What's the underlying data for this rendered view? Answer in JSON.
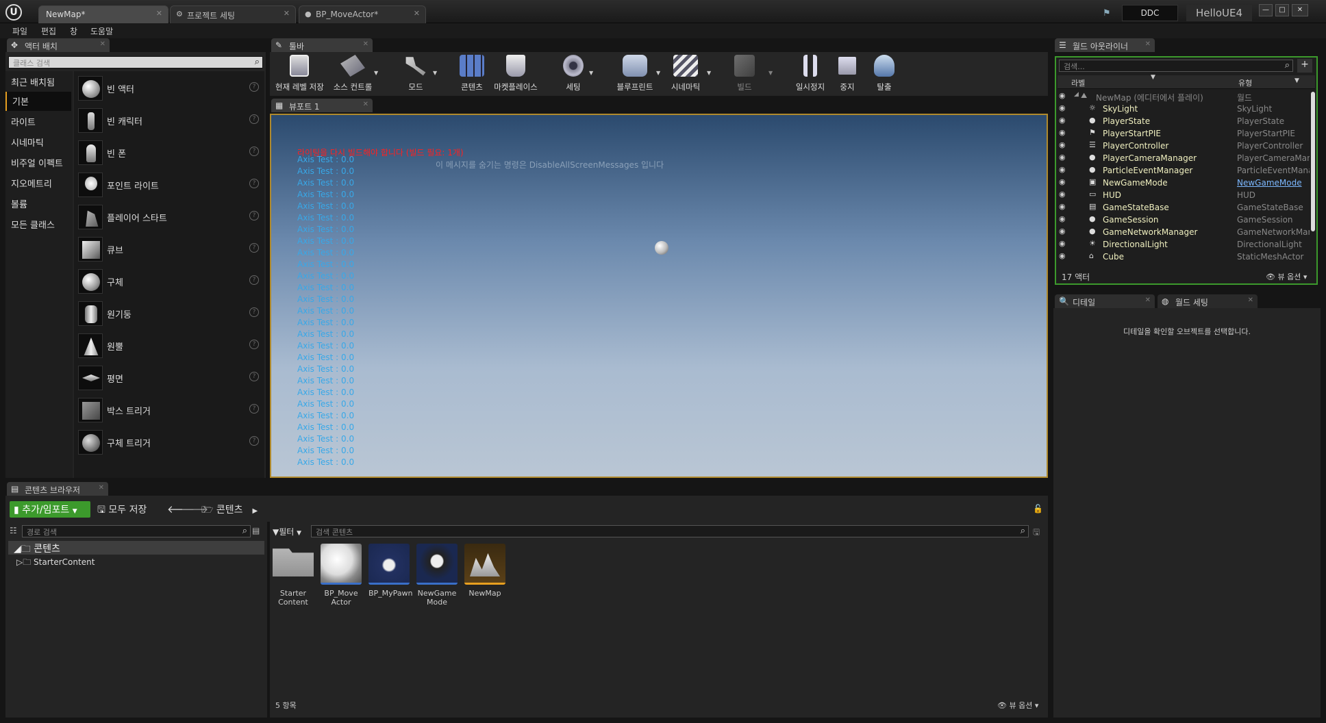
{
  "titlebar": {
    "tabs": [
      {
        "label": "NewMap*"
      },
      {
        "label": "프로젝트 세팅"
      },
      {
        "label": "BP_MoveActor*"
      }
    ],
    "ddc_label": "DDC",
    "project_name": "HelloUE4",
    "minimize": "—",
    "maximize": "□",
    "close": "✕"
  },
  "menu": {
    "items": [
      "파일",
      "편집",
      "창",
      "도움말"
    ]
  },
  "place_actors": {
    "tab": "액터 배치",
    "search_placeholder": "클래스 검색",
    "categories": [
      "최근 배치됨",
      "기본",
      "라이트",
      "시네마틱",
      "비주얼 이펙트",
      "지오메트리",
      "볼륨",
      "모든 클래스"
    ],
    "items": [
      "빈 액터",
      "빈 캐릭터",
      "빈 폰",
      "포인트 라이트",
      "플레이어 스타트",
      "큐브",
      "구체",
      "원기둥",
      "원뿔",
      "평면",
      "박스 트리거",
      "구체 트리거"
    ]
  },
  "toolbar": {
    "tab": "툴바",
    "buttons": [
      "현재 레벨 저장",
      "소스 컨트롤",
      "모드",
      "콘텐츠",
      "마켓플레이스",
      "세팅",
      "블루프린트",
      "시네마틱",
      "빌드",
      "일시정지",
      "중지",
      "탈출"
    ]
  },
  "viewport": {
    "tab": "뷰포트 1",
    "warning": "라이팅을 다시 빌드해야 합니다 (빌드 필요: 1개)",
    "hint": "이 메시지를 숨기는 명령은 DisableAllScreenMessages 입니다",
    "axis_lines": [
      "Axis Test : 0.0",
      "Axis Test : 0.0",
      "Axis Test : 0.0",
      "Axis Test : 0.0",
      "Axis Test : 0.0",
      "Axis Test : 0.0",
      "Axis Test : 0.0",
      "Axis Test : 0.0",
      "Axis Test : 0.0",
      "Axis Test : 0.0",
      "Axis Test : 0.0",
      "Axis Test : 0.0",
      "Axis Test : 0.0",
      "Axis Test : 0.0",
      "Axis Test : 0.0",
      "Axis Test : 0.0",
      "Axis Test : 0.0",
      "Axis Test : 0.0",
      "Axis Test : 0.0",
      "Axis Test : 0.0",
      "Axis Test : 0.0",
      "Axis Test : 0.0",
      "Axis Test : 0.0",
      "Axis Test : 0.0",
      "Axis Test : 0.0",
      "Axis Test : 0.0",
      "Axis Test : 0.0"
    ]
  },
  "outliner": {
    "tab": "월드 아웃라이너",
    "search_placeholder": "검색...",
    "col_label": "라벨",
    "col_type": "유형",
    "root": {
      "name": "NewMap (에디터에서 플레이)",
      "type": "월드"
    },
    "rows": [
      {
        "name": "SkyLight",
        "type": "SkyLight"
      },
      {
        "name": "PlayerState",
        "type": "PlayerState"
      },
      {
        "name": "PlayerStartPIE",
        "type": "PlayerStartPIE"
      },
      {
        "name": "PlayerController",
        "type": "PlayerController"
      },
      {
        "name": "PlayerCameraManager",
        "type": "PlayerCameraManager"
      },
      {
        "name": "ParticleEventManager",
        "type": "ParticleEventManager"
      },
      {
        "name": "NewGameMode",
        "type": "NewGameMode"
      },
      {
        "name": "HUD",
        "type": "HUD"
      },
      {
        "name": "GameStateBase",
        "type": "GameStateBase"
      },
      {
        "name": "GameSession",
        "type": "GameSession"
      },
      {
        "name": "GameNetworkManager",
        "type": "GameNetworkManager"
      },
      {
        "name": "DirectionalLight",
        "type": "DirectionalLight"
      },
      {
        "name": "Cube",
        "type": "StaticMeshActor"
      }
    ],
    "count": "17 액터",
    "view_options": "뷰 옵션"
  },
  "details": {
    "tab_details": "디테일",
    "tab_world": "월드 세팅",
    "empty_message": "디테일을 확인할 오브젝트를 선택합니다."
  },
  "content_browser": {
    "tab": "콘텐츠 브라우저",
    "add_import": "추가/임포트",
    "save_all": "모두 저장",
    "path_root": "콘텐츠",
    "path_search_placeholder": "경로 검색",
    "tree_root": "콘텐츠",
    "tree_child": "StarterContent",
    "filter_label": "필터",
    "content_search_placeholder": "검색 콘텐츠",
    "assets": [
      {
        "label": "Starter Content"
      },
      {
        "label": "BP_Move Actor"
      },
      {
        "label": "BP_MyPawn"
      },
      {
        "label": "NewGame Mode"
      },
      {
        "label": "NewMap"
      }
    ],
    "item_count": "5 항목",
    "view_options": "뷰 옵션"
  },
  "colors": {
    "accent": "#e8a020",
    "warning": "#ff2020",
    "axis_text": "#38a8e8",
    "add_button": "#3c9a2c",
    "outliner_name": "#f0f0c0"
  }
}
